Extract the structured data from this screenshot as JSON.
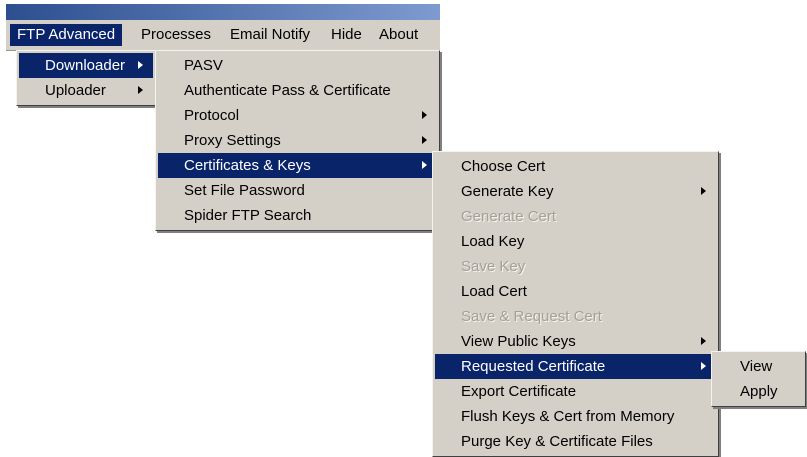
{
  "menubar": {
    "items": [
      {
        "label": "FTP Advanced",
        "active": true
      },
      {
        "label": "Processes"
      },
      {
        "label": "Email Notify"
      },
      {
        "label": "Hide"
      },
      {
        "label": "About"
      }
    ]
  },
  "menu_ftp_advanced": {
    "items": [
      {
        "label": "Downloader",
        "selected": true,
        "submenu": true
      },
      {
        "label": "Uploader",
        "submenu": true
      }
    ]
  },
  "menu_downloader": {
    "items": [
      {
        "label": "PASV"
      },
      {
        "label": "Authenticate Pass & Certificate"
      },
      {
        "label": "Protocol",
        "submenu": true
      },
      {
        "label": "Proxy Settings",
        "submenu": true
      },
      {
        "label": "Certificates & Keys",
        "selected": true,
        "submenu": true
      },
      {
        "label": "Set File Password"
      },
      {
        "label": "Spider FTP Search"
      }
    ]
  },
  "menu_certificates": {
    "items": [
      {
        "label": "Choose Cert"
      },
      {
        "label": "Generate Key",
        "submenu": true
      },
      {
        "label": "Generate Cert",
        "disabled": true
      },
      {
        "label": "Load Key"
      },
      {
        "label": "Save Key",
        "disabled": true
      },
      {
        "label": "Load Cert"
      },
      {
        "label": "Save & Request Cert",
        "disabled": true
      },
      {
        "label": "View Public Keys",
        "submenu": true
      },
      {
        "label": "Requested Certificate",
        "selected": true,
        "submenu": true
      },
      {
        "label": "Export Certificate"
      },
      {
        "label": "Flush Keys & Cert from Memory"
      },
      {
        "label": "Purge Key & Certificate Files"
      }
    ]
  },
  "menu_requested": {
    "items": [
      {
        "label": "View"
      },
      {
        "label": "Apply"
      }
    ]
  },
  "colors": {
    "menu_bg": "#d4d0c8",
    "highlight": "#0a246a",
    "disabled_text": "#a3a096",
    "titlebar_start": "#2d4f8f",
    "titlebar_end": "#7e9bd0"
  }
}
